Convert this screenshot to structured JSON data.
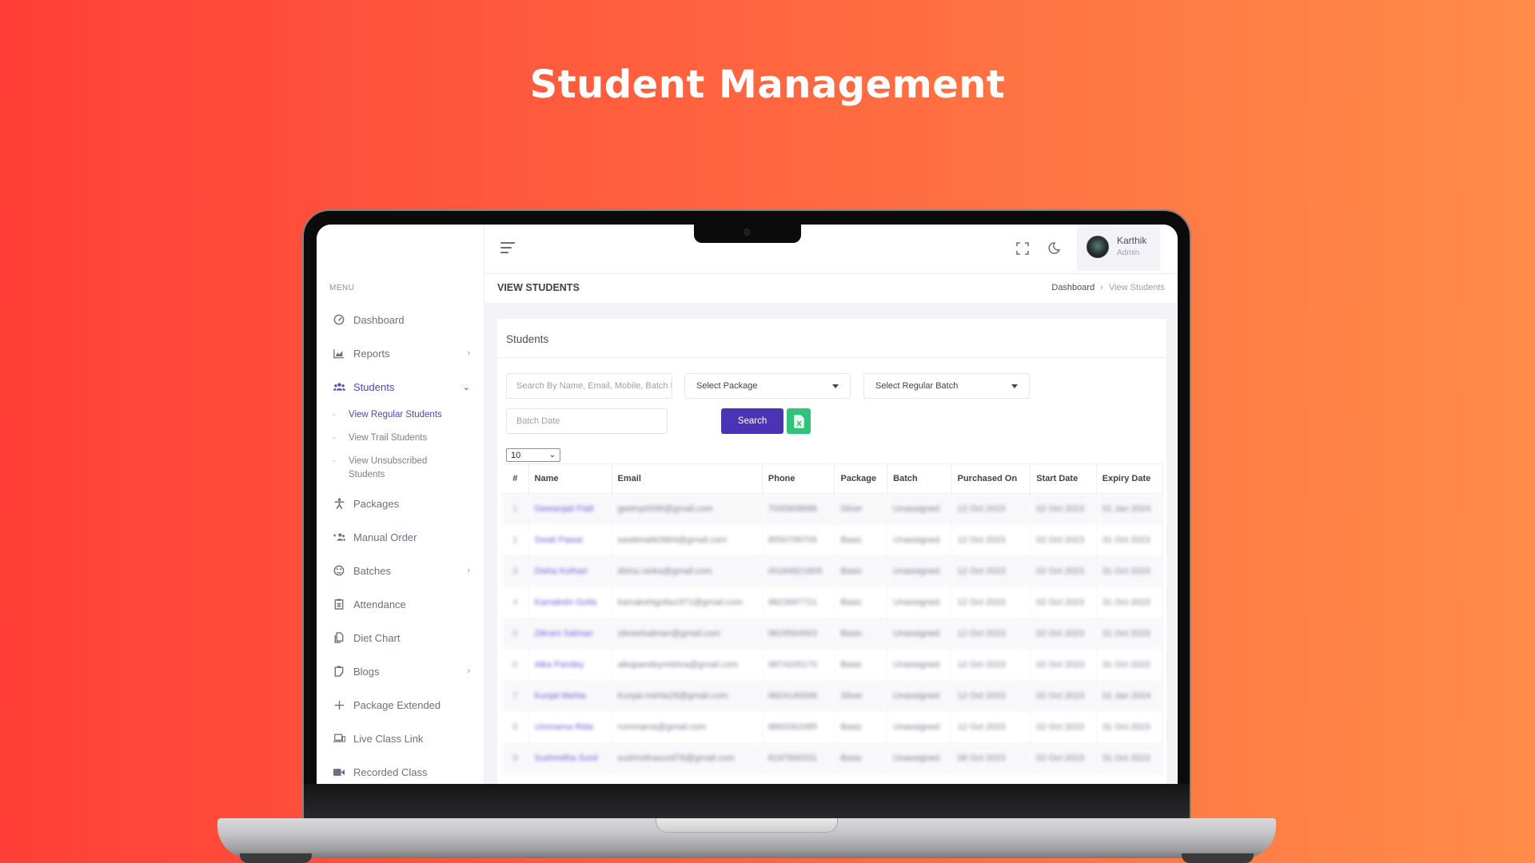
{
  "hero": {
    "title": "Student Management"
  },
  "sidebar": {
    "menu_title": "MENU",
    "items": [
      {
        "label": "Dashboard",
        "icon": "dashboard-gauge-icon",
        "chevron": ""
      },
      {
        "label": "Reports",
        "icon": "chart-icon",
        "chevron": "›"
      },
      {
        "label": "Students",
        "icon": "users-icon",
        "chevron": "⌄",
        "active": true
      },
      {
        "label": "Packages",
        "icon": "person-icon",
        "chevron": ""
      },
      {
        "label": "Manual Order",
        "icon": "user-add-icon",
        "chevron": ""
      },
      {
        "label": "Batches",
        "icon": "palette-icon",
        "chevron": "›"
      },
      {
        "label": "Attendance",
        "icon": "clipboard-icon",
        "chevron": ""
      },
      {
        "label": "Diet Chart",
        "icon": "copy-icon",
        "chevron": ""
      },
      {
        "label": "Blogs",
        "icon": "clipboard-edit-icon",
        "chevron": "›"
      },
      {
        "label": "Package Extended",
        "icon": "plus-icon",
        "chevron": ""
      },
      {
        "label": "Live Class Link",
        "icon": "laptop-icon",
        "chevron": ""
      },
      {
        "label": "Recorded Class",
        "icon": "video-icon",
        "chevron": ""
      }
    ],
    "students_sub": [
      {
        "label": "View Regular Students",
        "active": true
      },
      {
        "label": "View Trail Students"
      },
      {
        "label": "View Unsubscribed Students"
      }
    ],
    "dash": "-"
  },
  "topbar": {
    "user_name": "Karthik",
    "user_role": "Admin"
  },
  "page_header": {
    "title": "VIEW STUDENTS",
    "breadcrumb": [
      "Dashboard",
      "View Students"
    ],
    "separator": "›"
  },
  "card": {
    "title": "Students",
    "search_placeholder": "Search By Name, Email, Mobile, Batch Name",
    "package_select": "Select Package",
    "batch_select": "Select Regular Batch",
    "batch_date_placeholder": "Batch Date",
    "search_button": "Search",
    "page_size": "10"
  },
  "table": {
    "headers": [
      "#",
      "Name",
      "Email",
      "Phone",
      "Package",
      "Batch",
      "Purchased On",
      "Start Date",
      "Expiry Date"
    ],
    "rows": [
      [
        "1",
        "Geetanjali Patil",
        "geetnp0096@gmail.com",
        "7045808686",
        "Silver",
        "Unassigned",
        "12 Oct 2023",
        "02 Oct 2023",
        "01 Jan 2024"
      ],
      [
        "2",
        "Swati Pawar",
        "swatimalik0864@gmail.com",
        "8550799705",
        "Basic",
        "Unassigned",
        "12 Oct 2023",
        "02 Oct 2023",
        "31 Oct 2023"
      ],
      [
        "3",
        "Disha Kothari",
        "disha.ranka@gmail.com",
        "00184821805",
        "Basic",
        "Unassigned",
        "12 Oct 2023",
        "02 Oct 2023",
        "31 Oct 2023"
      ],
      [
        "4",
        "Kamakshi Gotla",
        "kamakshigotla1971@gmail.com",
        "9823697721",
        "Basic",
        "Unassigned",
        "12 Oct 2023",
        "02 Oct 2023",
        "31 Oct 2023"
      ],
      [
        "5",
        "Zikrani Salman",
        "zikreelsalman@gmail.com",
        "9819564563",
        "Basic",
        "Unassigned",
        "12 Oct 2023",
        "02 Oct 2023",
        "31 Oct 2023"
      ],
      [
        "6",
        "Alka Pandey",
        "alkapandeymishra@gmail.com",
        "9874205170",
        "Basic",
        "Unassigned",
        "12 Oct 2023",
        "02 Oct 2023",
        "31 Oct 2023"
      ],
      [
        "7",
        "Kunjal Mehta",
        "Kunjal.mehta28@gmail.com",
        "9824140006",
        "Silver",
        "Unassigned",
        "12 Oct 2023",
        "02 Oct 2023",
        "01 Jan 2024"
      ],
      [
        "8",
        "Ummama Rida",
        "rummama@gmail.com",
        "8892062085",
        "Basic",
        "Unassigned",
        "12 Oct 2023",
        "02 Oct 2023",
        "31 Oct 2023"
      ],
      [
        "9",
        "Sushmitha Sunil",
        "sushmithasunil78@gmail.com",
        "8197800331",
        "Basic",
        "Unassigned",
        "08 Oct 2023",
        "02 Oct 2023",
        "31 Oct 2023"
      ]
    ]
  },
  "colors": {
    "accent": "#4a33b5",
    "excel": "#2fc47a",
    "link": "#6a5fd8",
    "bg_start": "#ff3f37",
    "bg_end": "#ff8c48"
  }
}
